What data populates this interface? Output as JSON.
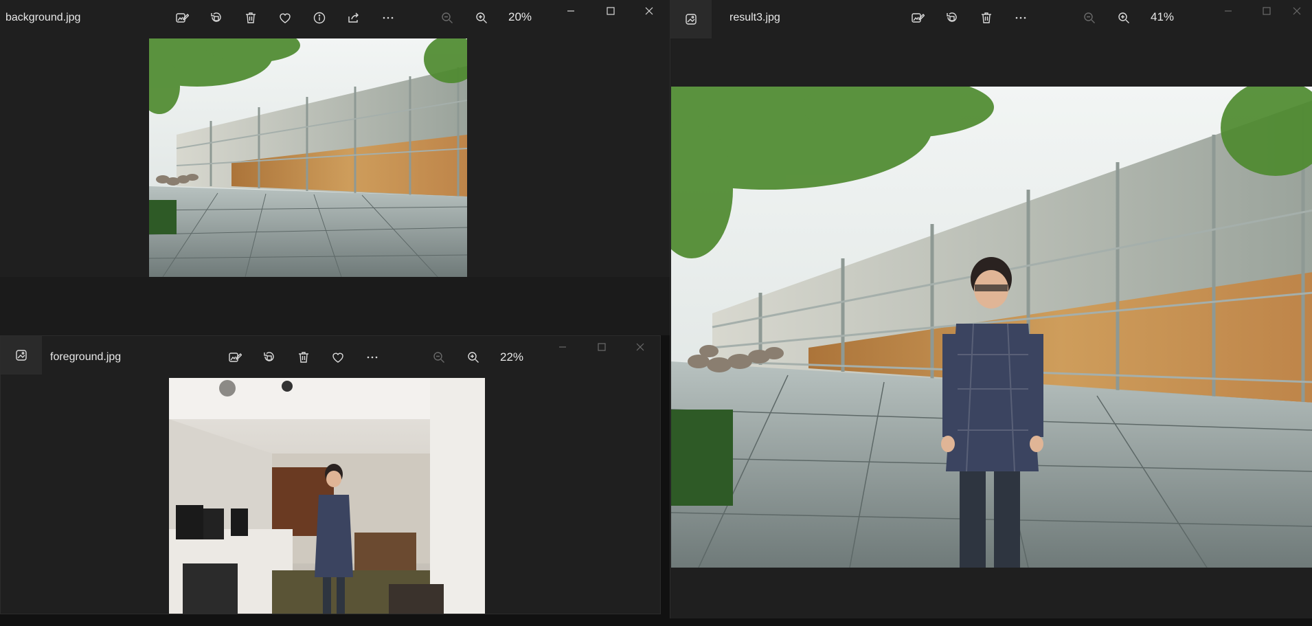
{
  "windows": {
    "background": {
      "title": "background.jpg",
      "zoom": "20%",
      "toolbar": [
        "edit-image-icon",
        "rotate-icon",
        "delete-icon",
        "favorite-icon",
        "info-icon",
        "share-icon",
        "more-icon"
      ]
    },
    "foreground": {
      "title": "foreground.jpg",
      "zoom": "22%",
      "toolbar": [
        "edit-image-icon",
        "rotate-icon",
        "delete-icon",
        "favorite-icon",
        "more-icon"
      ]
    },
    "result": {
      "title": "result3.jpg",
      "zoom": "41%",
      "toolbar": [
        "edit-image-icon",
        "rotate-icon",
        "delete-icon",
        "more-icon"
      ]
    }
  },
  "colors": {
    "window_bg": "#1f1f1f",
    "toolbar_fg": "#dcdcdc",
    "disabled_fg": "#6a6a6a"
  }
}
